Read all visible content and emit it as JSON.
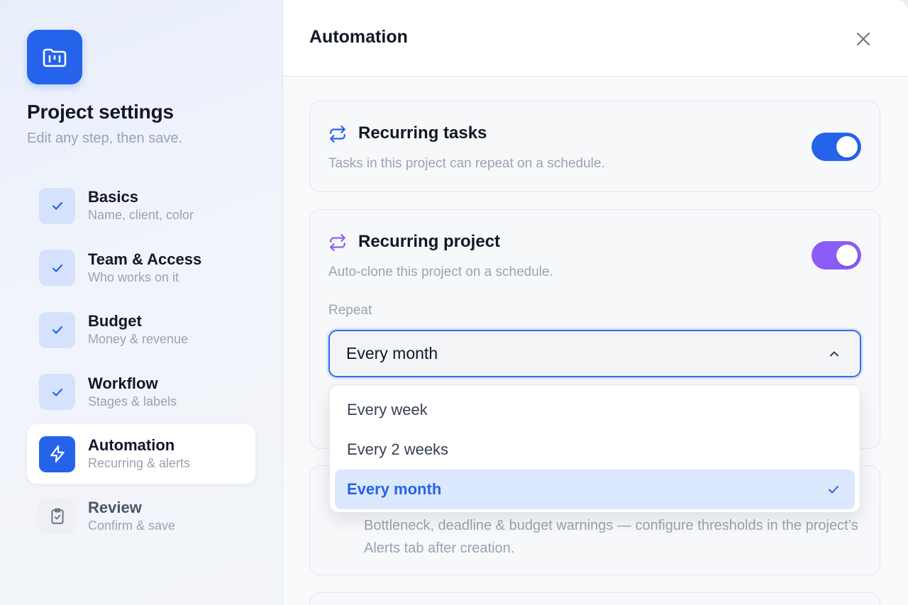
{
  "sidebar": {
    "title": "Project settings",
    "subtitle": "Edit any step, then save.",
    "steps": [
      {
        "title": "Basics",
        "desc": "Name, client, color",
        "state": "done"
      },
      {
        "title": "Team & Access",
        "desc": "Who works on it",
        "state": "done"
      },
      {
        "title": "Budget",
        "desc": "Money & revenue",
        "state": "done"
      },
      {
        "title": "Workflow",
        "desc": "Stages & labels",
        "state": "done"
      },
      {
        "title": "Automation",
        "desc": "Recurring & alerts",
        "state": "active"
      },
      {
        "title": "Review",
        "desc": "Confirm & save",
        "state": "pending"
      }
    ]
  },
  "main": {
    "title": "Automation",
    "recurring_tasks": {
      "title": "Recurring tasks",
      "desc": "Tasks in this project can repeat on a schedule.",
      "enabled": true
    },
    "recurring_project": {
      "title": "Recurring project",
      "desc": "Auto-clone this project on a schedule.",
      "enabled": true,
      "repeat_label": "Repeat",
      "repeat_value": "Every month",
      "options": [
        "Every week",
        "Every 2 weeks",
        "Every month"
      ],
      "selected_index": 2
    },
    "alerts": {
      "desc": "Bottleneck, deadline & budget warnings — configure thresholds in the project’s Alerts tab after creation."
    }
  },
  "colors": {
    "accent": "#2563eb",
    "purple": "#8b5cf6",
    "muted_text": "#9aa3b2"
  },
  "icons": {
    "logo": "kanban-folder-icon",
    "done": "check-icon",
    "active": "lightning-icon",
    "pending": "clipboard-check-icon",
    "recurring": "repeat-icon",
    "close": "close-icon"
  }
}
